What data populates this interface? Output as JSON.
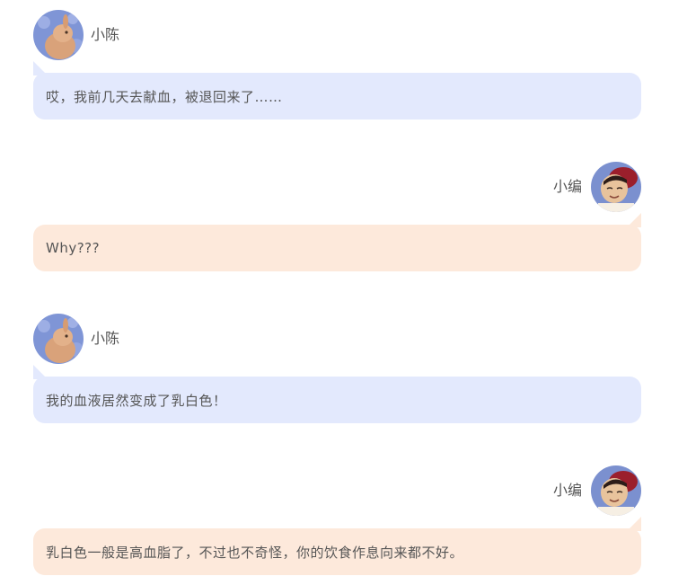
{
  "colors": {
    "left_bubble": "#e3e9fd",
    "right_bubble": "#fde9db",
    "text": "#555555"
  },
  "messages": [
    {
      "side": "left",
      "avatar": "rabbit-avatar",
      "name": "小陈",
      "text": "哎，我前几天去献血，被退回来了……"
    },
    {
      "side": "right",
      "avatar": "girl-avatar",
      "name": "小编",
      "text": "Why???"
    },
    {
      "side": "left",
      "avatar": "rabbit-avatar",
      "name": "小陈",
      "text": "我的血液居然变成了乳白色！"
    },
    {
      "side": "right",
      "avatar": "girl-avatar",
      "name": "小编",
      "text": "乳白色一般是高血脂了，不过也不奇怪，你的饮食作息向来都不好。"
    }
  ]
}
